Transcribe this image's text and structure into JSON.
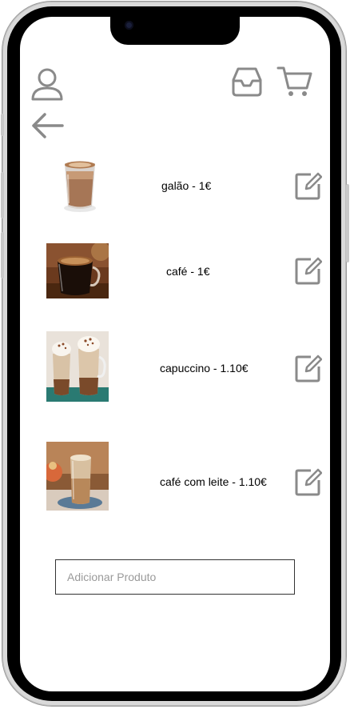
{
  "header": {
    "profile_icon": "user-icon",
    "inbox_icon": "inbox-icon",
    "cart_icon": "shopping-cart-icon",
    "back_icon": "arrow-left-icon"
  },
  "products": [
    {
      "label": "galão - 1€",
      "image": "galao-photo",
      "edit_icon": "edit-icon"
    },
    {
      "label": "café - 1€",
      "image": "cafe-photo",
      "edit_icon": "edit-icon"
    },
    {
      "label": "capuccino - 1.10€",
      "image": "capuccino-photo",
      "edit_icon": "edit-icon"
    },
    {
      "label": "café com leite - 1.10€",
      "image": "cafe-com-leite-photo",
      "edit_icon": "edit-icon"
    }
  ],
  "add_product": {
    "placeholder": "Adicionar Produto",
    "value": ""
  },
  "colors": {
    "icon_gray": "#8a8a8a",
    "frame": "#000000",
    "screen": "#ffffff"
  }
}
